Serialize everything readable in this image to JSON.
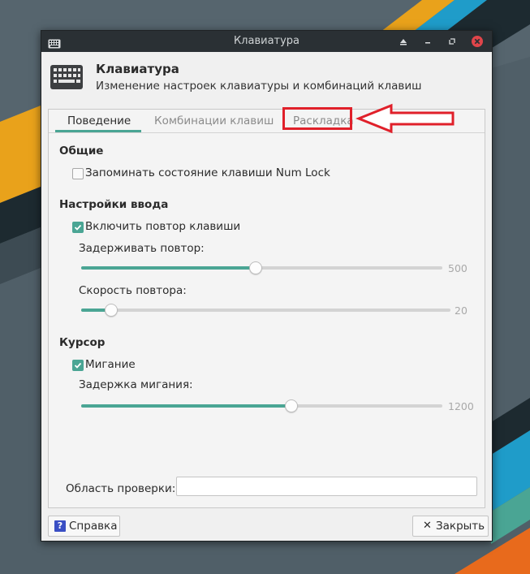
{
  "window": {
    "title": "Клавиатура"
  },
  "header": {
    "title": "Клавиатура",
    "subtitle": "Изменение настроек клавиатуры и комбинаций клавиш"
  },
  "tabs": [
    {
      "label": "Поведение",
      "active": true
    },
    {
      "label": "Комбинации клавиш",
      "active": false
    },
    {
      "label": "Раскладка",
      "active": false
    }
  ],
  "sections": {
    "general": {
      "title": "Общие",
      "numlock": {
        "label": "Запоминать состояние клавиши Num Lock",
        "checked": false
      }
    },
    "input": {
      "title": "Настройки ввода",
      "repeat": {
        "label": "Включить повтор клавиши",
        "checked": true
      },
      "delay": {
        "label": "Задерживать повтор:",
        "value": "500",
        "fraction": 0.48
      },
      "speed": {
        "label": "Скорость повтора:",
        "value": "20",
        "fraction": 0.08
      }
    },
    "cursor": {
      "title": "Курсор",
      "blink": {
        "label": "Мигание",
        "checked": true
      },
      "blink_delay": {
        "label": "Задержка мигания:",
        "value": "1200",
        "fraction": 0.58
      }
    }
  },
  "test_area": {
    "label": "Область проверки:",
    "value": ""
  },
  "buttons": {
    "help": "Справка",
    "close": "Закрыть"
  },
  "colors": {
    "accent": "#4aa594",
    "annotation": "#e0202a",
    "titlebar": "#2a3034"
  }
}
